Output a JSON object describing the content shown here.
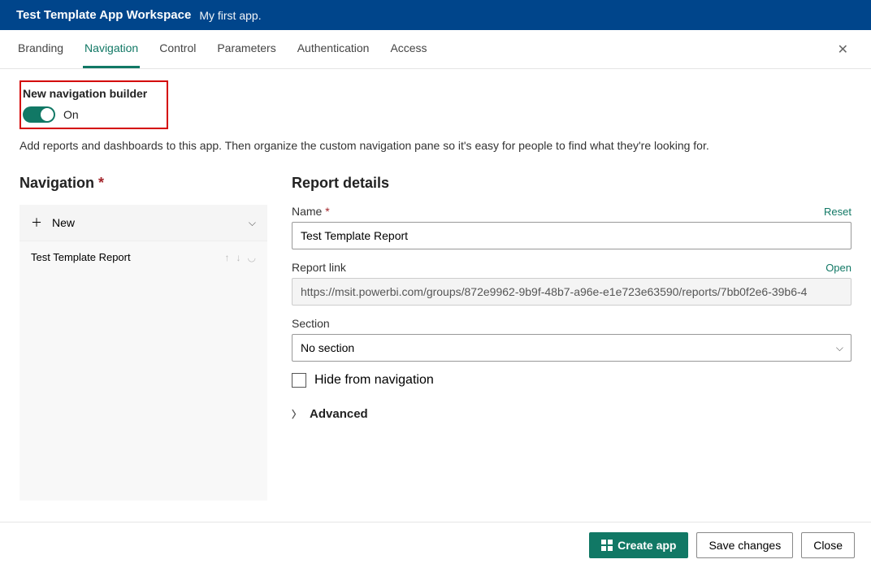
{
  "header": {
    "title": "Test Template App Workspace",
    "subtitle": "My first app."
  },
  "tabs": {
    "items": [
      {
        "label": "Branding"
      },
      {
        "label": "Navigation"
      },
      {
        "label": "Control"
      },
      {
        "label": "Parameters"
      },
      {
        "label": "Authentication"
      },
      {
        "label": "Access"
      }
    ],
    "active_index": 1
  },
  "builder": {
    "title": "New navigation builder",
    "state": "On",
    "description": "Add reports and dashboards to this app. Then organize the custom navigation pane so it's easy for people to find what they're looking for."
  },
  "nav_panel": {
    "heading": "Navigation",
    "new_label": "New",
    "items": [
      {
        "label": "Test Template Report"
      }
    ]
  },
  "details": {
    "heading": "Report details",
    "name_label": "Name",
    "name_value": "Test Template Report",
    "reset": "Reset",
    "link_label": "Report link",
    "link_value": "https://msit.powerbi.com/groups/872e9962-9b9f-48b7-a96e-e1e723e63590/reports/7bb0f2e6-39b6-4",
    "open": "Open",
    "section_label": "Section",
    "section_value": "No section",
    "hide_label": "Hide from navigation",
    "advanced": "Advanced"
  },
  "footer": {
    "create": "Create app",
    "save": "Save changes",
    "close": "Close"
  }
}
